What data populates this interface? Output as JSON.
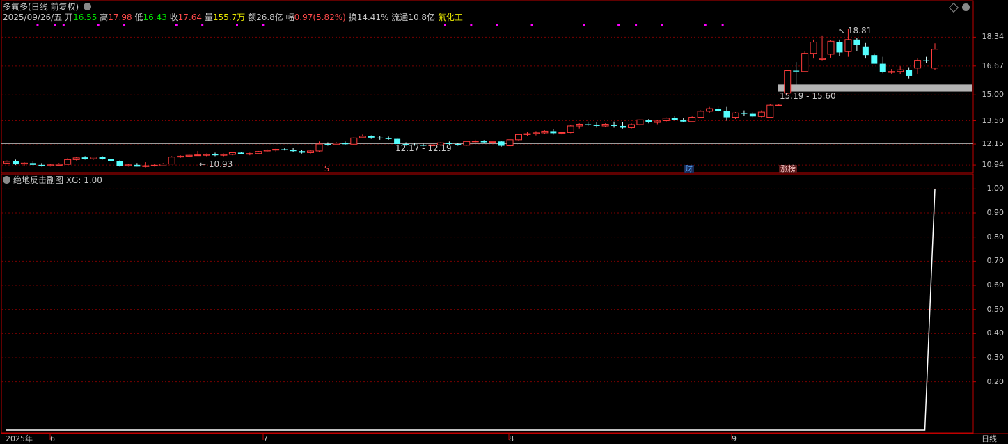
{
  "header": {
    "stock_name": "多氟多",
    "period_label": "(日线 前复权)",
    "date": "2025/09/26/五",
    "open_label": "开",
    "open": "16.55",
    "high_label": "高",
    "high": "17.98",
    "low_label": "低",
    "low": "16.43",
    "close_label": "收",
    "close": "17.64",
    "vol_label": "量",
    "vol": "155.7万",
    "amount_label": "额",
    "amount": "26.8亿",
    "change_label": "幅",
    "change": "0.97(5.82%)",
    "turnover_label": "换",
    "turnover": "14.41%",
    "float_label": "流通",
    "float": "10.8亿",
    "industry": "氟化工"
  },
  "sub_header": {
    "indicator_name": "绝地反击副图",
    "indicator_value": "XG: 1.00"
  },
  "annotations": {
    "low_label": "10.93",
    "high_label": "18.81",
    "range1": "12.17 - 12.19",
    "range2": "15.19 - 15.60",
    "tag_s": "S",
    "tag_cai": "财",
    "tag_zhangbang": "涨榜"
  },
  "x_axis": {
    "year": "2025年",
    "months": [
      "6",
      "7",
      "8",
      "9"
    ],
    "period_button": "日线"
  },
  "colors": {
    "up": "#ff3c3c",
    "down": "#54ffff",
    "grid": "#7a0000",
    "frame": "#c00000",
    "text_white": "#c8c8c8",
    "text_green": "#00e000",
    "text_red": "#ff4a4a",
    "text_yellow": "#e8e800",
    "marker": "#ff00ff",
    "support_band": "#b4b4b4"
  },
  "chart_data": [
    {
      "type": "candlestick",
      "ylim": [
        10.5,
        19.2
      ],
      "y_ticks": [
        "18.34",
        "16.67",
        "15.00",
        "13.50",
        "12.15",
        "10.94"
      ],
      "reference_line": 12.17,
      "support_zone": [
        15.19,
        15.6
      ],
      "candles": [
        [
          11.05,
          11.2,
          11.0,
          11.15
        ],
        [
          11.15,
          11.25,
          10.95,
          10.98
        ],
        [
          11.0,
          11.1,
          10.9,
          11.05
        ],
        [
          11.05,
          11.15,
          10.92,
          10.95
        ],
        [
          10.95,
          11.05,
          10.85,
          10.9
        ],
        [
          10.9,
          11.0,
          10.85,
          10.95
        ],
        [
          10.92,
          11.05,
          10.88,
          10.98
        ],
        [
          10.98,
          11.35,
          10.95,
          11.25
        ],
        [
          11.25,
          11.4,
          11.2,
          11.35
        ],
        [
          11.38,
          11.45,
          11.25,
          11.3
        ],
        [
          11.3,
          11.42,
          11.25,
          11.4
        ],
        [
          11.4,
          11.45,
          11.25,
          11.3
        ],
        [
          11.3,
          11.4,
          11.1,
          11.15
        ],
        [
          11.15,
          11.2,
          10.85,
          10.9
        ],
        [
          10.9,
          11.0,
          10.85,
          10.95
        ],
        [
          10.95,
          11.05,
          10.85,
          10.85
        ],
        [
          10.85,
          11.1,
          10.8,
          10.9
        ],
        [
          10.9,
          11.0,
          10.85,
          10.93
        ],
        [
          10.9,
          11.05,
          10.88,
          11.0
        ],
        [
          11.0,
          11.45,
          10.98,
          11.4
        ],
        [
          11.4,
          11.5,
          11.35,
          11.45
        ],
        [
          11.45,
          11.55,
          11.4,
          11.5
        ],
        [
          11.5,
          11.75,
          11.48,
          11.52
        ],
        [
          11.5,
          11.6,
          11.45,
          11.55
        ],
        [
          11.55,
          11.65,
          11.45,
          11.5
        ],
        [
          11.5,
          11.6,
          11.45,
          11.55
        ],
        [
          11.55,
          11.7,
          11.5,
          11.65
        ],
        [
          11.65,
          11.7,
          11.55,
          11.58
        ],
        [
          11.58,
          11.65,
          11.5,
          11.6
        ],
        [
          11.6,
          11.75,
          11.55,
          11.72
        ],
        [
          11.75,
          11.85,
          11.7,
          11.8
        ],
        [
          11.8,
          11.88,
          11.72,
          11.85
        ],
        [
          11.85,
          11.9,
          11.78,
          11.82
        ],
        [
          11.82,
          11.92,
          11.7,
          11.74
        ],
        [
          11.74,
          11.8,
          11.6,
          11.65
        ],
        [
          11.65,
          11.8,
          11.6,
          11.75
        ],
        [
          11.75,
          12.3,
          11.7,
          12.15
        ],
        [
          12.15,
          12.25,
          12.05,
          12.12
        ],
        [
          12.12,
          12.25,
          12.08,
          12.2
        ],
        [
          12.2,
          12.3,
          12.1,
          12.14
        ],
        [
          12.14,
          12.55,
          12.1,
          12.5
        ],
        [
          12.52,
          12.7,
          12.48,
          12.6
        ],
        [
          12.6,
          12.65,
          12.45,
          12.52
        ],
        [
          12.52,
          12.6,
          12.4,
          12.48
        ],
        [
          12.48,
          12.58,
          12.4,
          12.45
        ],
        [
          12.45,
          12.52,
          12.05,
          12.15
        ],
        [
          12.15,
          12.25,
          12.05,
          12.12
        ],
        [
          12.12,
          12.2,
          12.05,
          12.1
        ],
        [
          12.1,
          12.18,
          12.02,
          12.05
        ],
        [
          12.05,
          12.15,
          12.0,
          12.1
        ],
        [
          12.1,
          12.25,
          12.05,
          12.22
        ],
        [
          12.22,
          12.3,
          12.1,
          12.15
        ],
        [
          12.15,
          12.2,
          12.05,
          12.08
        ],
        [
          12.08,
          12.35,
          12.05,
          12.3
        ],
        [
          12.3,
          12.4,
          12.2,
          12.32
        ],
        [
          12.32,
          12.38,
          12.2,
          12.25
        ],
        [
          12.25,
          12.32,
          12.18,
          12.3
        ],
        [
          12.3,
          12.35,
          12.0,
          12.05
        ],
        [
          12.05,
          12.45,
          12.0,
          12.4
        ],
        [
          12.4,
          12.75,
          12.35,
          12.7
        ],
        [
          12.7,
          12.85,
          12.6,
          12.75
        ],
        [
          12.75,
          12.9,
          12.65,
          12.8
        ],
        [
          12.8,
          12.95,
          12.72,
          12.9
        ],
        [
          12.9,
          13.0,
          12.7,
          12.78
        ],
        [
          12.78,
          12.85,
          12.7,
          12.82
        ],
        [
          12.82,
          13.25,
          12.78,
          13.2
        ],
        [
          13.2,
          13.35,
          13.05,
          13.3
        ],
        [
          13.3,
          13.45,
          13.2,
          13.28
        ],
        [
          13.28,
          13.4,
          13.1,
          13.2
        ],
        [
          13.2,
          13.35,
          13.15,
          13.3
        ],
        [
          13.28,
          13.45,
          13.1,
          13.2
        ],
        [
          13.2,
          13.4,
          13.05,
          13.1
        ],
        [
          13.1,
          13.35,
          13.05,
          13.28
        ],
        [
          13.28,
          13.6,
          13.2,
          13.55
        ],
        [
          13.55,
          13.6,
          13.35,
          13.4
        ],
        [
          13.4,
          13.55,
          13.3,
          13.48
        ],
        [
          13.5,
          13.7,
          13.4,
          13.65
        ],
        [
          13.65,
          13.8,
          13.5,
          13.55
        ],
        [
          13.55,
          13.65,
          13.4,
          13.45
        ],
        [
          13.45,
          13.75,
          13.4,
          13.7
        ],
        [
          13.7,
          14.1,
          13.65,
          14.05
        ],
        [
          14.05,
          14.3,
          13.95,
          14.2
        ],
        [
          14.2,
          14.35,
          14.0,
          14.05
        ],
        [
          14.05,
          14.3,
          13.5,
          13.7
        ],
        [
          13.7,
          14.0,
          13.6,
          13.95
        ],
        [
          13.95,
          14.1,
          13.8,
          13.9
        ],
        [
          13.9,
          14.0,
          13.7,
          13.75
        ],
        [
          13.75,
          14.1,
          13.7,
          14.0
        ],
        [
          13.7,
          14.45,
          13.65,
          14.4
        ],
        [
          14.4,
          14.45,
          14.4,
          14.4
        ],
        [
          15.1,
          16.45,
          15.05,
          16.4
        ],
        [
          16.4,
          16.9,
          15.6,
          16.35
        ],
        [
          16.35,
          17.5,
          16.3,
          17.4
        ],
        [
          17.4,
          18.2,
          17.1,
          18.05
        ],
        [
          17.05,
          18.4,
          17.0,
          17.1
        ],
        [
          17.35,
          18.15,
          17.15,
          18.1
        ],
        [
          18.05,
          18.2,
          17.25,
          17.45
        ],
        [
          17.5,
          18.81,
          17.2,
          18.2
        ],
        [
          18.2,
          18.3,
          17.55,
          17.9
        ],
        [
          17.8,
          18.0,
          17.1,
          17.3
        ],
        [
          17.3,
          17.4,
          16.8,
          16.8
        ],
        [
          16.8,
          17.2,
          16.25,
          16.3
        ],
        [
          16.3,
          16.5,
          16.2,
          16.35
        ],
        [
          16.35,
          16.65,
          16.2,
          16.45
        ],
        [
          16.45,
          16.6,
          15.95,
          16.1
        ],
        [
          16.55,
          17.1,
          16.2,
          17.0
        ],
        [
          17.0,
          17.2,
          16.85,
          16.95
        ],
        [
          16.55,
          17.98,
          16.43,
          17.64
        ]
      ]
    },
    {
      "type": "line",
      "series": [
        {
          "values_note_first_zero_count": 106,
          "start": 0,
          "end": 1
        }
      ],
      "ylim": [
        0,
        1.05
      ],
      "y_ticks": [
        "1.00",
        "0.90",
        "0.80",
        "0.70",
        "0.60",
        "0.50",
        "0.40",
        "0.30",
        "0.20"
      ]
    }
  ]
}
